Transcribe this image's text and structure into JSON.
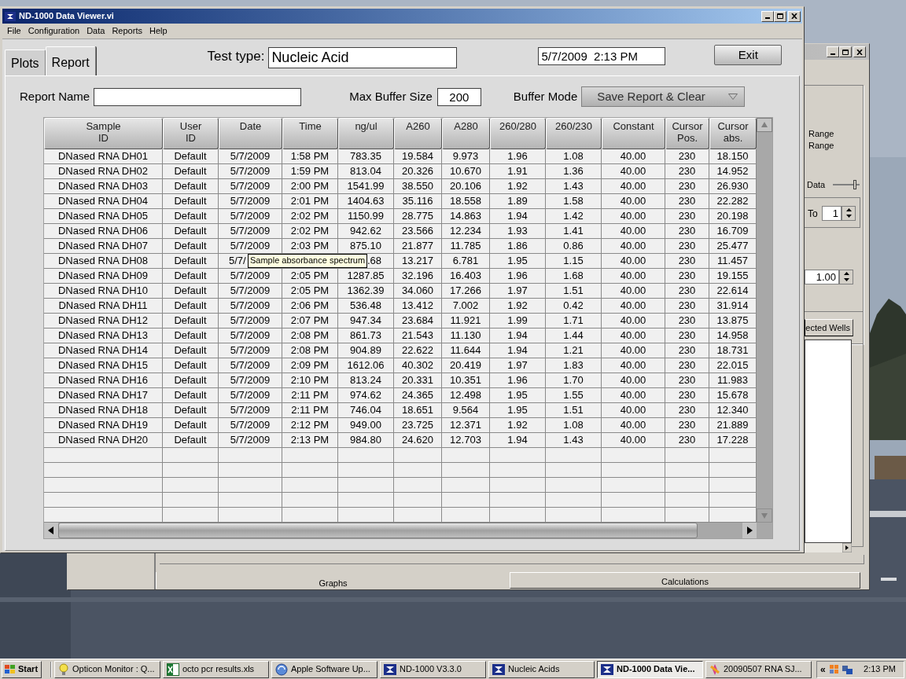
{
  "back_window": {
    "options": [
      "Range",
      "Range"
    ],
    "data_label": "Data",
    "slider": {
      "level": 0.85
    },
    "to_label": "To",
    "to_value": "1",
    "factor_value": "1.00",
    "list_tab": "ected Wells",
    "bottom_tabs": [
      {
        "label": "Graphs",
        "selected": true
      },
      {
        "label": "Calculations",
        "selected": false
      }
    ]
  },
  "window": {
    "title": "ND-1000 Data Viewer.vi"
  },
  "menu": [
    "File",
    "Configuration",
    "Data",
    "Reports",
    "Help"
  ],
  "tabs": [
    {
      "label": "Plots",
      "selected": false
    },
    {
      "label": "Report",
      "selected": true
    }
  ],
  "test_type": {
    "label": "Test type:",
    "value": "Nucleic Acid"
  },
  "datetime": "5/7/2009  2:13 PM",
  "exit_button": "Exit",
  "report_name": {
    "label": "Report Name"
  },
  "max_buffer": {
    "label": "Max Buffer Size",
    "value": "200"
  },
  "buffer_mode": {
    "label": "Buffer Mode",
    "value": "Save Report & Clear"
  },
  "table": {
    "columns": [
      "Sample\nID",
      "User\nID",
      "Date",
      "Time",
      "ng/ul",
      "A260",
      "A280",
      "260/280",
      "260/230",
      "Constant",
      "Cursor\nPos.",
      "Cursor\nabs."
    ],
    "rows": [
      [
        "DNased RNA DH01",
        "Default",
        "5/7/2009",
        "1:58 PM",
        "783.35",
        "19.584",
        "9.973",
        "1.96",
        "1.08",
        "40.00",
        "230",
        "18.150"
      ],
      [
        "DNased RNA DH02",
        "Default",
        "5/7/2009",
        "1:59 PM",
        "813.04",
        "20.326",
        "10.670",
        "1.91",
        "1.36",
        "40.00",
        "230",
        "14.952"
      ],
      [
        "DNased RNA DH03",
        "Default",
        "5/7/2009",
        "2:00 PM",
        "1541.99",
        "38.550",
        "20.106",
        "1.92",
        "1.43",
        "40.00",
        "230",
        "26.930"
      ],
      [
        "DNased RNA DH04",
        "Default",
        "5/7/2009",
        "2:01 PM",
        "1404.63",
        "35.116",
        "18.558",
        "1.89",
        "1.58",
        "40.00",
        "230",
        "22.282"
      ],
      [
        "DNased RNA DH05",
        "Default",
        "5/7/2009",
        "2:02 PM",
        "1150.99",
        "28.775",
        "14.863",
        "1.94",
        "1.42",
        "40.00",
        "230",
        "20.198"
      ],
      [
        "DNased RNA DH06",
        "Default",
        "5/7/2009",
        "2:02 PM",
        "942.62",
        "23.566",
        "12.234",
        "1.93",
        "1.41",
        "40.00",
        "230",
        "16.709"
      ],
      [
        "DNased RNA DH07",
        "Default",
        "5/7/2009",
        "2:03 PM",
        "875.10",
        "21.877",
        "11.785",
        "1.86",
        "0.86",
        "40.00",
        "230",
        "25.477"
      ],
      [
        "DNased RNA DH08",
        "Default",
        {
          "kind": "cut_right",
          "text": "5/7/"
        },
        {
          "kind": "covered"
        },
        {
          "kind": "cut_left",
          "text": ".68"
        },
        "13.217",
        "6.781",
        "1.95",
        "1.15",
        "40.00",
        "230",
        "11.457"
      ],
      [
        "DNased RNA DH09",
        "Default",
        "5/7/2009",
        "2:05 PM",
        "1287.85",
        "32.196",
        "16.403",
        "1.96",
        "1.68",
        "40.00",
        "230",
        "19.155"
      ],
      [
        "DNased RNA DH10",
        "Default",
        "5/7/2009",
        "2:05 PM",
        "1362.39",
        "34.060",
        "17.266",
        "1.97",
        "1.51",
        "40.00",
        "230",
        "22.614"
      ],
      [
        "DNased RNA DH11",
        "Default",
        "5/7/2009",
        "2:06 PM",
        "536.48",
        "13.412",
        "7.002",
        "1.92",
        "0.42",
        "40.00",
        "230",
        "31.914"
      ],
      [
        "DNased RNA DH12",
        "Default",
        "5/7/2009",
        "2:07 PM",
        "947.34",
        "23.684",
        "11.921",
        "1.99",
        "1.71",
        "40.00",
        "230",
        "13.875"
      ],
      [
        "DNased RNA DH13",
        "Default",
        "5/7/2009",
        "2:08 PM",
        "861.73",
        "21.543",
        "11.130",
        "1.94",
        "1.44",
        "40.00",
        "230",
        "14.958"
      ],
      [
        "DNased RNA DH14",
        "Default",
        "5/7/2009",
        "2:08 PM",
        "904.89",
        "22.622",
        "11.644",
        "1.94",
        "1.21",
        "40.00",
        "230",
        "18.731"
      ],
      [
        "DNased RNA DH15",
        "Default",
        "5/7/2009",
        "2:09 PM",
        "1612.06",
        "40.302",
        "20.419",
        "1.97",
        "1.83",
        "40.00",
        "230",
        "22.015"
      ],
      [
        "DNased RNA DH16",
        "Default",
        "5/7/2009",
        "2:10 PM",
        "813.24",
        "20.331",
        "10.351",
        "1.96",
        "1.70",
        "40.00",
        "230",
        "11.983"
      ],
      [
        "DNased RNA DH17",
        "Default",
        "5/7/2009",
        "2:11 PM",
        "974.62",
        "24.365",
        "12.498",
        "1.95",
        "1.55",
        "40.00",
        "230",
        "15.678"
      ],
      [
        "DNased RNA DH18",
        "Default",
        "5/7/2009",
        "2:11 PM",
        "746.04",
        "18.651",
        "9.564",
        "1.95",
        "1.51",
        "40.00",
        "230",
        "12.340"
      ],
      [
        "DNased RNA DH19",
        "Default",
        "5/7/2009",
        "2:12 PM",
        "949.00",
        "23.725",
        "12.371",
        "1.92",
        "1.08",
        "40.00",
        "230",
        "21.889"
      ],
      [
        "DNased RNA DH20",
        "Default",
        "5/7/2009",
        "2:13 PM",
        "984.80",
        "24.620",
        "12.703",
        "1.94",
        "1.43",
        "40.00",
        "230",
        "17.228"
      ]
    ]
  },
  "tooltip": "Sample absorbance spectrum",
  "taskbar": {
    "start": "Start",
    "items": [
      {
        "label": "Opticon Monitor : Q...",
        "kind": "bulb",
        "selected": false
      },
      {
        "label": "octo pcr results.xls",
        "kind": "sheet",
        "selected": false
      },
      {
        "label": "Apple Software Up...",
        "kind": "update",
        "selected": false
      },
      {
        "label": "ND-1000 V3.3.0",
        "kind": "nd",
        "selected": false
      },
      {
        "label": "Nucleic Acids",
        "kind": "nd",
        "selected": false
      },
      {
        "label": "ND-1000 Data Vie...",
        "kind": "nd",
        "selected": true
      },
      {
        "label": "20090507 RNA SJ...",
        "kind": "flower",
        "selected": false
      }
    ],
    "chevron": "«",
    "clock": "2:13 PM"
  }
}
